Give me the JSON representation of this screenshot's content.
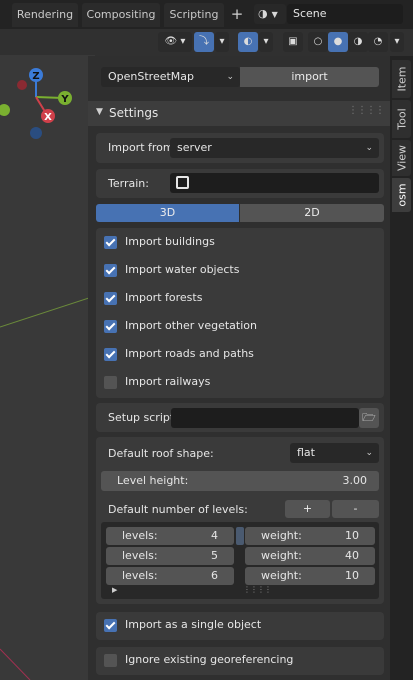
{
  "workspace_tabs": [
    "Rendering",
    "Compositing",
    "Scripting"
  ],
  "scene_name": "Scene",
  "provider": {
    "selected": "OpenStreetMap",
    "import_label": "import"
  },
  "tabs": [
    "Item",
    "Tool",
    "View",
    "osm"
  ],
  "settings": {
    "title": "Settings",
    "import_from_label": "Import from:",
    "import_from_value": "server",
    "terrain_label": "Terrain:",
    "mode_3d": "3D",
    "mode_2d": "2D",
    "checks": [
      {
        "label": "Import buildings",
        "checked": true
      },
      {
        "label": "Import water objects",
        "checked": true
      },
      {
        "label": "Import forests",
        "checked": true
      },
      {
        "label": "Import other vegetation",
        "checked": true
      },
      {
        "label": "Import roads and paths",
        "checked": true
      },
      {
        "label": "Import railways",
        "checked": false
      }
    ],
    "setup_script_label": "Setup script:",
    "roof_label": "Default roof shape:",
    "roof_value": "flat",
    "level_height_label": "Level height:",
    "level_height_value": "3.00",
    "default_levels_label": "Default number of levels:",
    "plus": "+",
    "minus": "-",
    "levels_rows": [
      {
        "levels_label": "levels:",
        "levels_value": "4",
        "weight_label": "weight:",
        "weight_value": "10"
      },
      {
        "levels_label": "levels:",
        "levels_value": "5",
        "weight_label": "weight:",
        "weight_value": "40"
      },
      {
        "levels_label": "levels:",
        "levels_value": "6",
        "weight_label": "weight:",
        "weight_value": "10"
      }
    ],
    "single_object_label": "Import as a single object",
    "single_object_checked": true,
    "ignore_geo_label": "Ignore existing georeferencing",
    "ignore_geo_checked": false
  },
  "colors": {
    "accent": "#4772b3",
    "panel": "#3a3a3a",
    "background": "#303030"
  },
  "gizmo": {
    "x": "X",
    "y": "Y",
    "z": "Z"
  }
}
